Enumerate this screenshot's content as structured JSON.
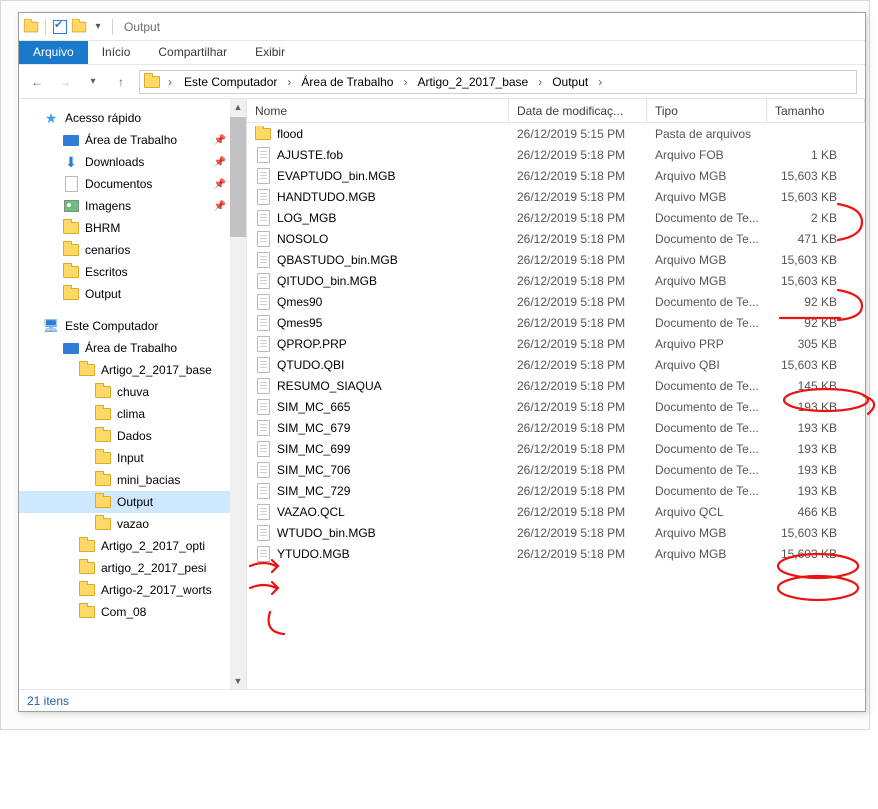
{
  "window": {
    "title": "Output"
  },
  "ribbon": {
    "file": "Arquivo",
    "home": "Início",
    "share": "Compartilhar",
    "view": "Exibir"
  },
  "breadcrumbs": [
    "Este Computador",
    "Área de Trabalho",
    "Artigo_2_2017_base",
    "Output"
  ],
  "columns": {
    "name": "Nome",
    "date": "Data de modificaç...",
    "type": "Tipo",
    "size": "Tamanho"
  },
  "tree": {
    "quick": "Acesso rápido",
    "quick_items": [
      {
        "label": "Área de Trabalho",
        "icon": "desktop",
        "pinned": true
      },
      {
        "label": "Downloads",
        "icon": "download",
        "pinned": true
      },
      {
        "label": "Documentos",
        "icon": "doc",
        "pinned": true
      },
      {
        "label": "Imagens",
        "icon": "image",
        "pinned": true
      },
      {
        "label": "BHRM",
        "icon": "folder"
      },
      {
        "label": "cenarios",
        "icon": "folder"
      },
      {
        "label": "Escritos",
        "icon": "folder"
      },
      {
        "label": "Output",
        "icon": "folder"
      }
    ],
    "pc": "Este Computador",
    "desk": "Área de Trabalho",
    "proj": "Artigo_2_2017_base",
    "proj_items": [
      "chuva",
      "clima",
      "Dados",
      "Input",
      "mini_bacias",
      "Output",
      "vazao"
    ],
    "proj_selected": "Output",
    "siblings": [
      "Artigo_2_2017_opti",
      "artigo_2_2017_pesi",
      "Artigo-2_2017_worts",
      "Com_08"
    ]
  },
  "files": [
    {
      "name": "flood",
      "date": "26/12/2019 5:15 PM",
      "type": "Pasta de arquivos",
      "size": "",
      "icon": "folder"
    },
    {
      "name": "AJUSTE.fob",
      "date": "26/12/2019 5:18 PM",
      "type": "Arquivo FOB",
      "size": "1 KB",
      "icon": "file"
    },
    {
      "name": "EVAPTUDO_bin.MGB",
      "date": "26/12/2019 5:18 PM",
      "type": "Arquivo MGB",
      "size": "15,603 KB",
      "icon": "file"
    },
    {
      "name": "HANDTUDO.MGB",
      "date": "26/12/2019 5:18 PM",
      "type": "Arquivo MGB",
      "size": "15,603 KB",
      "icon": "file"
    },
    {
      "name": "LOG_MGB",
      "date": "26/12/2019 5:18 PM",
      "type": "Documento de Te...",
      "size": "2 KB",
      "icon": "file"
    },
    {
      "name": "NOSOLO",
      "date": "26/12/2019 5:18 PM",
      "type": "Documento de Te...",
      "size": "471 KB",
      "icon": "file"
    },
    {
      "name": "QBASTUDO_bin.MGB",
      "date": "26/12/2019 5:18 PM",
      "type": "Arquivo MGB",
      "size": "15,603 KB",
      "icon": "file"
    },
    {
      "name": "QITUDO_bin.MGB",
      "date": "26/12/2019 5:18 PM",
      "type": "Arquivo MGB",
      "size": "15,603 KB",
      "icon": "file"
    },
    {
      "name": "Qmes90",
      "date": "26/12/2019 5:18 PM",
      "type": "Documento de Te...",
      "size": "92 KB",
      "icon": "file"
    },
    {
      "name": "Qmes95",
      "date": "26/12/2019 5:18 PM",
      "type": "Documento de Te...",
      "size": "92 KB",
      "icon": "file"
    },
    {
      "name": "QPROP.PRP",
      "date": "26/12/2019 5:18 PM",
      "type": "Arquivo PRP",
      "size": "305 KB",
      "icon": "file"
    },
    {
      "name": "QTUDO.QBI",
      "date": "26/12/2019 5:18 PM",
      "type": "Arquivo QBI",
      "size": "15,603 KB",
      "icon": "file"
    },
    {
      "name": "RESUMO_SIAQUA",
      "date": "26/12/2019 5:18 PM",
      "type": "Documento de Te...",
      "size": "145 KB",
      "icon": "file"
    },
    {
      "name": "SIM_MC_665",
      "date": "26/12/2019 5:18 PM",
      "type": "Documento de Te...",
      "size": "193 KB",
      "icon": "file"
    },
    {
      "name": "SIM_MC_679",
      "date": "26/12/2019 5:18 PM",
      "type": "Documento de Te...",
      "size": "193 KB",
      "icon": "file"
    },
    {
      "name": "SIM_MC_699",
      "date": "26/12/2019 5:18 PM",
      "type": "Documento de Te...",
      "size": "193 KB",
      "icon": "file"
    },
    {
      "name": "SIM_MC_706",
      "date": "26/12/2019 5:18 PM",
      "type": "Documento de Te...",
      "size": "193 KB",
      "icon": "file"
    },
    {
      "name": "SIM_MC_729",
      "date": "26/12/2019 5:18 PM",
      "type": "Documento de Te...",
      "size": "193 KB",
      "icon": "file"
    },
    {
      "name": "VAZAO.QCL",
      "date": "26/12/2019 5:18 PM",
      "type": "Arquivo QCL",
      "size": "466 KB",
      "icon": "file"
    },
    {
      "name": "WTUDO_bin.MGB",
      "date": "26/12/2019 5:18 PM",
      "type": "Arquivo MGB",
      "size": "15,603 KB",
      "icon": "file"
    },
    {
      "name": "YTUDO.MGB",
      "date": "26/12/2019 5:18 PM",
      "type": "Arquivo MGB",
      "size": "15,603 KB",
      "icon": "file"
    }
  ],
  "status": "21 itens"
}
